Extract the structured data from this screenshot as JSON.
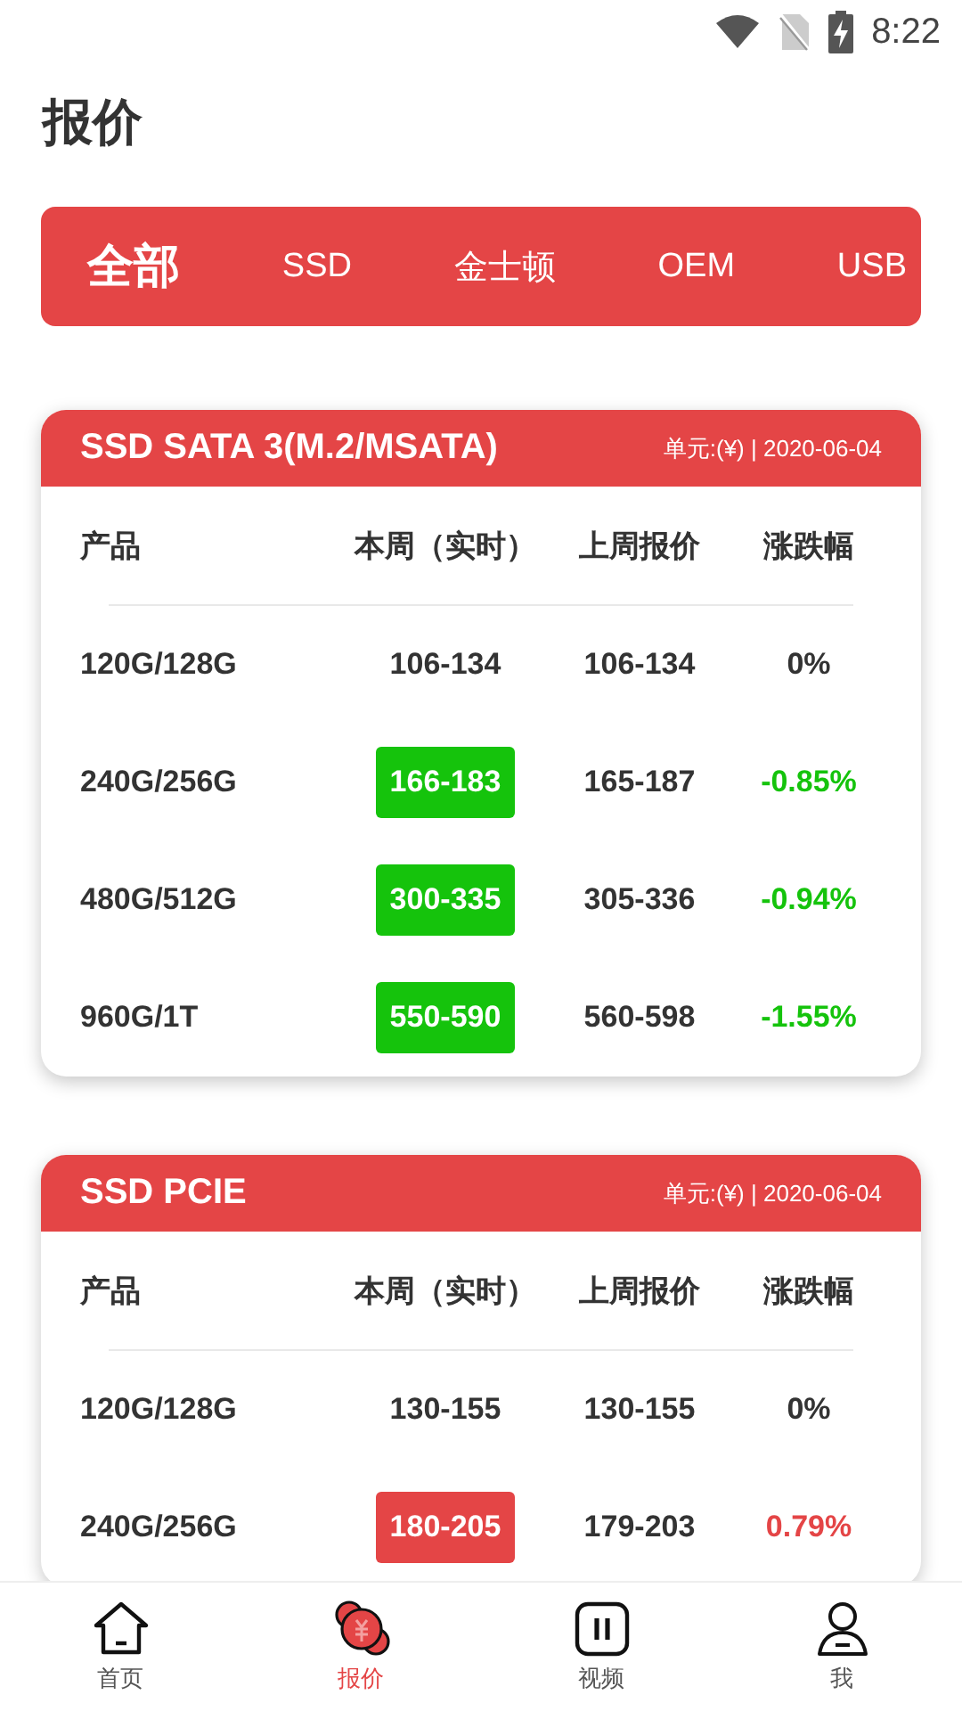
{
  "status_bar": {
    "time": "8:22"
  },
  "page_title": "报价",
  "categories": [
    {
      "label": "全部",
      "selected": true
    },
    {
      "label": "SSD",
      "selected": false
    },
    {
      "label": "金士顿",
      "selected": false
    },
    {
      "label": "OEM",
      "selected": false
    },
    {
      "label": "USB",
      "selected": false
    }
  ],
  "tables": [
    {
      "title": "SSD SATA 3(M.2/MSATA)",
      "meta": "单元:(¥) | 2020-06-04",
      "columns": [
        "产品",
        "本周（实时）",
        "上周报价",
        "涨跌幅"
      ],
      "rows": [
        {
          "product": "120G/128G",
          "current": "106-134",
          "last_week": "106-134",
          "change": "0%",
          "kind": "flat"
        },
        {
          "product": "240G/256G",
          "current": "166-183",
          "last_week": "165-187",
          "change": "-0.85%",
          "kind": "down"
        },
        {
          "product": "480G/512G",
          "current": "300-335",
          "last_week": "305-336",
          "change": "-0.94%",
          "kind": "down"
        },
        {
          "product": "960G/1T",
          "current": "550-590",
          "last_week": "560-598",
          "change": "-1.55%",
          "kind": "down"
        }
      ]
    },
    {
      "title": "SSD PCIE",
      "meta": "单元:(¥) | 2020-06-04",
      "columns": [
        "产品",
        "本周（实时）",
        "上周报价",
        "涨跌幅"
      ],
      "rows": [
        {
          "product": "120G/128G",
          "current": "130-155",
          "last_week": "130-155",
          "change": "0%",
          "kind": "flat"
        },
        {
          "product": "240G/256G",
          "current": "180-205",
          "last_week": "179-203",
          "change": "0.79%",
          "kind": "up"
        }
      ]
    }
  ],
  "bottom_nav": [
    {
      "label": "首页",
      "selected": false
    },
    {
      "label": "报价",
      "selected": true
    },
    {
      "label": "视频",
      "selected": false
    },
    {
      "label": "我",
      "selected": false
    }
  ]
}
